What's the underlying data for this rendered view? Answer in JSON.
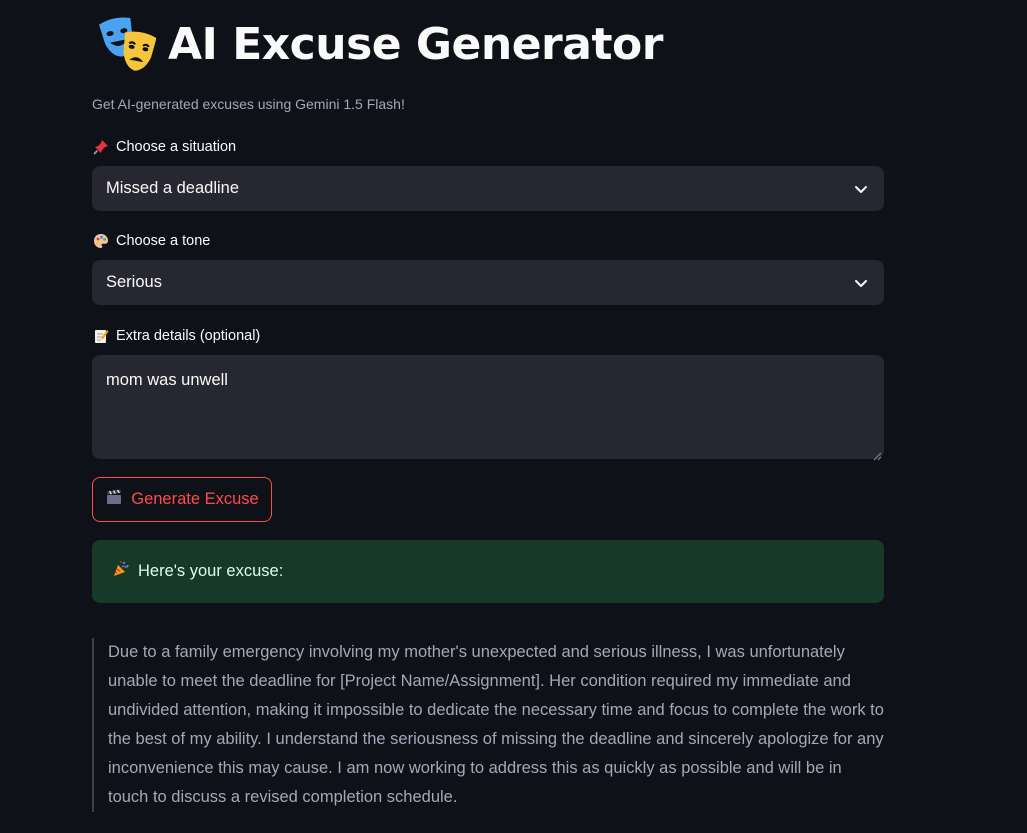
{
  "header": {
    "title": "AI Excuse Generator",
    "title_icon": "theater-masks-icon",
    "subtitle": "Get AI-generated excuses using Gemini 1.5 Flash!"
  },
  "situation": {
    "label": "Choose a situation",
    "label_icon": "pushpin-icon",
    "value": "Missed a deadline"
  },
  "tone": {
    "label": "Choose a tone",
    "label_icon": "palette-icon",
    "value": "Serious"
  },
  "details": {
    "label": "Extra details (optional)",
    "label_icon": "memo-icon",
    "value": "mom was unwell"
  },
  "generate_button": {
    "label": "Generate Excuse",
    "icon": "clapper-board-icon"
  },
  "result": {
    "heading": "Here's your excuse:",
    "heading_icon": "party-popper-icon",
    "text": "Due to a family emergency involving my mother's unexpected and serious illness, I was unfortunately unable to meet the deadline for [Project Name/Assignment]. Her condition required my immediate and undivided attention, making it impossible to dedicate the necessary time and focus to complete the work to the best of my ability. I understand the seriousness of missing the deadline and sincerely apologize for any inconvenience this may cause. I am now working to address this as quickly as possible and will be in touch to discuss a revised completion schedule."
  },
  "colors": {
    "background": "#0e1117",
    "input_bg": "#262730",
    "accent": "#ff4b4b",
    "success_bg": "#173928",
    "muted_text": "#a3a8b8"
  }
}
